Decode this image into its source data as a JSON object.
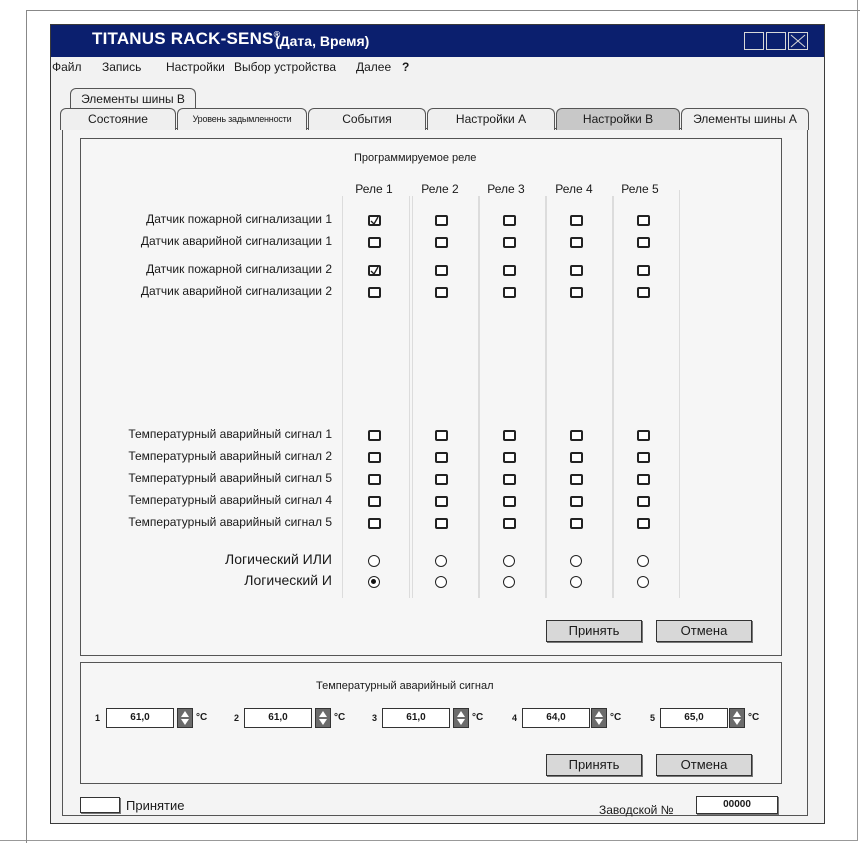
{
  "window": {
    "app_title": "TITANUS RACK-SENS",
    "app_title_mark": "®",
    "subtitle": "(Дата, Время)"
  },
  "menu": [
    "Файл",
    "Запись",
    "Настройки",
    "Выбор устройства",
    "Далее",
    "?"
  ],
  "tabs": {
    "top_row": "Элементы шины В",
    "main_row": [
      "Состояние",
      "Уровень задымленности",
      "События",
      "Настройки А",
      "Настройки В",
      "Элементы шины А"
    ],
    "active": "Настройки В"
  },
  "relay_section": {
    "title": "Программируемое реле",
    "columns": [
      "Реле 1",
      "Реле 2",
      "Реле 3",
      "Реле 4",
      "Реле 5"
    ],
    "detector_rows": [
      {
        "label": "Датчик пожарной сигнализации 1",
        "checked": [
          true,
          false,
          false,
          false,
          false
        ]
      },
      {
        "label": "Датчик аварийной сигнализации 1",
        "checked": [
          false,
          false,
          false,
          false,
          false
        ]
      },
      {
        "label": "Датчик пожарной сигнализации 2",
        "checked": [
          true,
          false,
          false,
          false,
          false
        ]
      },
      {
        "label": "Датчик аварийной сигнализации 2",
        "checked": [
          false,
          false,
          false,
          false,
          false
        ]
      }
    ],
    "temp_rows": [
      {
        "label": "Температурный аварийный сигнал 1",
        "checked": [
          false,
          false,
          false,
          false,
          false
        ]
      },
      {
        "label": "Температурный аварийный сигнал 2",
        "checked": [
          false,
          false,
          false,
          false,
          false
        ]
      },
      {
        "label": "Температурный аварийный сигнал 5",
        "checked": [
          false,
          false,
          false,
          false,
          false
        ]
      },
      {
        "label": "Температурный аварийный сигнал 4",
        "checked": [
          false,
          false,
          false,
          false,
          false
        ]
      },
      {
        "label": "Температурный аварийный сигнал 5",
        "checked": [
          false,
          false,
          false,
          false,
          false
        ]
      }
    ],
    "logic_rows": [
      {
        "label": "Логический ИЛИ",
        "selected": [
          false,
          false,
          false,
          false,
          false
        ]
      },
      {
        "label": "Логический И",
        "selected": [
          true,
          false,
          false,
          false,
          false
        ]
      }
    ],
    "accept_label": "Принять",
    "cancel_label": "Отмена"
  },
  "temp_alarm": {
    "title": "Температурный аварийный сигнал",
    "channels": [
      {
        "num": "1",
        "value": "61,0"
      },
      {
        "num": "2",
        "value": "61,0"
      },
      {
        "num": "3",
        "value": "61,0"
      },
      {
        "num": "4",
        "value": "64,0"
      },
      {
        "num": "5",
        "value": "65,0"
      }
    ],
    "unit": "°C",
    "accept_label": "Принять",
    "cancel_label": "Отмена"
  },
  "footer": {
    "accept_text": "Принятие",
    "serial_label": "Заводской №",
    "serial_value": "00000"
  }
}
